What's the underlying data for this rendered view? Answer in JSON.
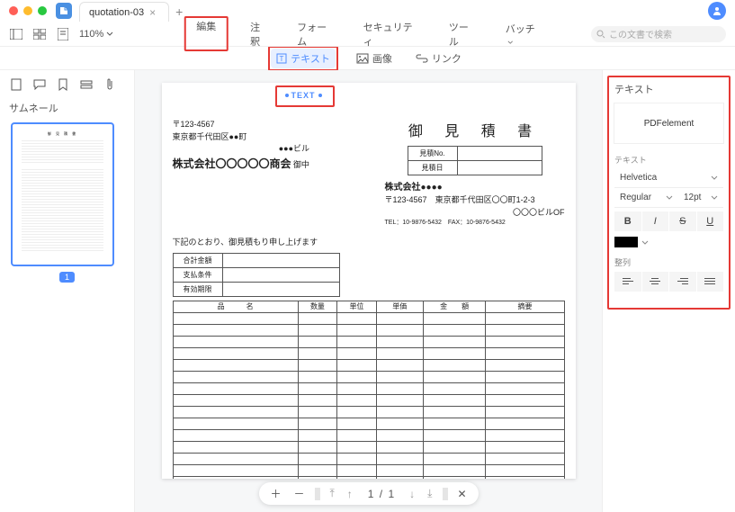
{
  "window": {
    "tab_title": "quotation-03",
    "new_tab_label": "+",
    "zoom": "110%",
    "search_placeholder": "この文書で検索"
  },
  "main_tabs": [
    "編集",
    "注釈",
    "フォーム",
    "セキュリティ",
    "ツール",
    "バッチ"
  ],
  "main_tabs_active": 0,
  "sub_tools": {
    "text": "テキスト",
    "image": "画像",
    "link": "リンク"
  },
  "left": {
    "title": "サムネール",
    "page_number": "1"
  },
  "page_bar": {
    "current": "1",
    "total": "1"
  },
  "doc": {
    "selected_text": "TEXT",
    "title": "御 見 積 書",
    "from": {
      "postal": "〒123-4567",
      "addr": "東京都千代田区●●町",
      "bldg": "●●●ビル",
      "company": "株式会社〇〇〇〇〇商会",
      "suffix": "御中"
    },
    "quote_rows": [
      {
        "label": "見積No.",
        "value": ""
      },
      {
        "label": "見積日",
        "value": ""
      }
    ],
    "to": {
      "company": "株式会社●●●●",
      "postal": "〒123-4567",
      "addr": "東京都千代田区〇〇町1-2-3",
      "bldg": "〇〇〇ビルOF",
      "tel": "TEL：10-9876-5432　FAX：10-9876-5432"
    },
    "notice": "下記のとおり、御見積もり申し上げます",
    "info_rows": [
      {
        "label": "合計金額",
        "value": ""
      },
      {
        "label": "支払条件",
        "value": ""
      },
      {
        "label": "有効期限",
        "value": ""
      }
    ],
    "columns": [
      "品　　　名",
      "数量",
      "単位",
      "単価",
      "金　　額",
      "摘要"
    ],
    "body_rows": 17
  },
  "right": {
    "panel_title": "テキスト",
    "preview": "PDFelement",
    "section_text": "テキスト",
    "font": "Helvetica",
    "weight": "Regular",
    "size": "12pt",
    "section_align": "整列"
  }
}
